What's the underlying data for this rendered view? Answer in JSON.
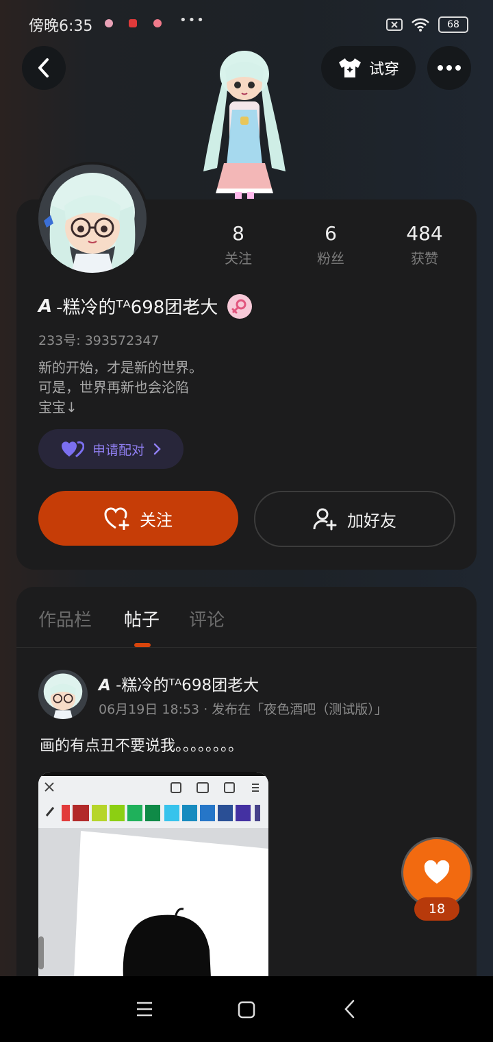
{
  "status_bar": {
    "time": "傍晚6:35",
    "battery": "68",
    "extra_dots": "•••"
  },
  "header": {
    "try_on_label": "试穿"
  },
  "profile": {
    "stats": [
      {
        "value": "8",
        "label": "关注"
      },
      {
        "value": "6",
        "label": "粉丝"
      },
      {
        "value": "484",
        "label": "获赞"
      }
    ],
    "name_prefix": "A",
    "name": "-糕冷的ᵀᴬ698团老大",
    "id_line": "233号: 393572347",
    "bio": [
      "新的开始，才是新的世界。",
      "可是，世界再新也会沦陷",
      "宝宝↓"
    ],
    "pair_label": "申请配对",
    "follow_label": "关注",
    "add_friend_label": "加好友"
  },
  "tabs": [
    {
      "label": "作品栏",
      "active": false
    },
    {
      "label": "帖子",
      "active": true
    },
    {
      "label": "评论",
      "active": false
    }
  ],
  "post": {
    "author_prefix": "A",
    "author_name": "-糕冷的ᵀᴬ698团老大",
    "meta": "06月19日 18:53 · 发布在「夜色酒吧（测试版）」",
    "text": "画的有点丑不要说我。。。。。。。。"
  },
  "like": {
    "count": "18"
  },
  "colors": {
    "accent": "#c63d07",
    "like": "#f26a10",
    "pair": "#8f7ef0",
    "card": "#1c1c1d"
  }
}
